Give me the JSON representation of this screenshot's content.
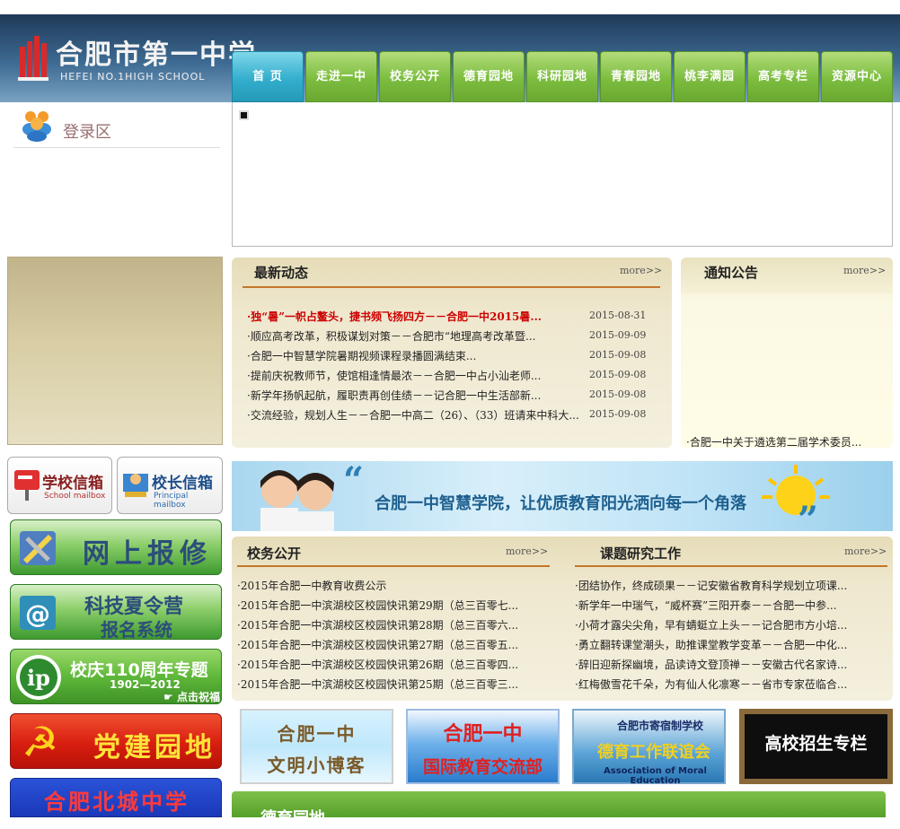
{
  "header": {
    "logo_cn": "合肥市第一中学",
    "logo_en": "HEFEI NO.1HIGH SCHOOL"
  },
  "nav": {
    "items": [
      {
        "label": "首 页",
        "active": true
      },
      {
        "label": "走进一中"
      },
      {
        "label": "校务公开"
      },
      {
        "label": "德育园地"
      },
      {
        "label": "科研园地"
      },
      {
        "label": "青春园地"
      },
      {
        "label": "桃李满园"
      },
      {
        "label": "高考专栏"
      },
      {
        "label": "资源中心"
      }
    ]
  },
  "login": {
    "label": "登录区"
  },
  "news": {
    "title": "最新动态",
    "more": "more>>",
    "items": [
      {
        "text": "独“暑”一帜占鳌头，捷书频飞扬四方－－合肥一中2015暑...",
        "date": "2015-08-31",
        "highlight": true
      },
      {
        "text": "顺应高考改革，积极谋划对策－－合肥市“地理高考改革暨...",
        "date": "2015-09-09"
      },
      {
        "text": "合肥一中智慧学院暑期视频课程录播圆满结束...",
        "date": "2015-09-08"
      },
      {
        "text": "提前庆祝教师节，使馆相逢情最浓－－合肥一中占小汕老师...",
        "date": "2015-09-08"
      },
      {
        "text": "新学年扬帆起航，履职责再创佳绩－－记合肥一中生活部新...",
        "date": "2015-09-08"
      },
      {
        "text": "交流经验，规划人生－－合肥一中高二（26）、（33）班请来中科大...",
        "date": "2015-09-08"
      }
    ]
  },
  "notice": {
    "title": "通知公告",
    "more": "more>>",
    "items": [
      "合肥一中关于遴选第二届学术委员..."
    ]
  },
  "mailboxes": {
    "school": "学校信箱",
    "school_en": "School mailbox",
    "principal": "校长信箱",
    "principal_en": "Principal mailbox"
  },
  "sidebar_buttons": {
    "repair": "网上报修",
    "camp_line1": "科技夏令营",
    "camp_line2": "报名系统",
    "anniv_title": "校庆110周年专题",
    "anniv_years": "1902—2012",
    "anniv_link": "点击祝福",
    "party": "党建园地",
    "beicheng": "合肥北城中学"
  },
  "banner": {
    "text": "合肥一中智慧学院，让优质教育阳光洒向每一个角落",
    "quote_open": "“",
    "quote_close": "”"
  },
  "affairs": {
    "title": "校务公开",
    "more": "more>>",
    "items": [
      "2015年合肥一中教育收费公示",
      "2015年合肥一中滨湖校区校园快讯第29期（总三百零七...",
      "2015年合肥一中滨湖校区校园快讯第28期（总三百零六...",
      "2015年合肥一中滨湖校区校园快讯第27期（总三百零五...",
      "2015年合肥一中滨湖校区校园快讯第26期（总三百零四...",
      "2015年合肥一中滨湖校区校园快讯第25期（总三百零三..."
    ]
  },
  "research": {
    "title": "课题研究工作",
    "more": "more>>",
    "items": [
      "团结协作，终成硕果－－记安徽省教育科学规划立项课...",
      "新学年一中瑞气，“威杯赛”三阳开泰－－合肥一中参...",
      "小荷才露尖尖角，早有蜻蜓立上头－－记合肥市方小培...",
      "勇立翻转课堂潮头，助推课堂教学变革－－合肥一中化...",
      "辞旧迎新探幽境，品读诗文登顶禅－－安徽古代名家诗...",
      "红梅傲雪花千朵，为有仙人化凛寒－－省市专家莅临合..."
    ]
  },
  "bottom_banners": {
    "blog_line1": "合肥一中",
    "blog_line2": "文明小博客",
    "intl_line1": "合肥一中",
    "intl_line2": "国际教育交流部",
    "moral_line1": "合肥市寄宿制学校",
    "moral_line2": "德育工作联谊会",
    "moral_en": "Association of Moral Education",
    "college": "高校招生专栏"
  },
  "next_section": {
    "title": "德育园地"
  },
  "colors": {
    "nav_green": "#7cbd3f",
    "nav_active": "#33aecd",
    "highlight_red": "#cc0000",
    "header_blue": "#2b4f73"
  }
}
